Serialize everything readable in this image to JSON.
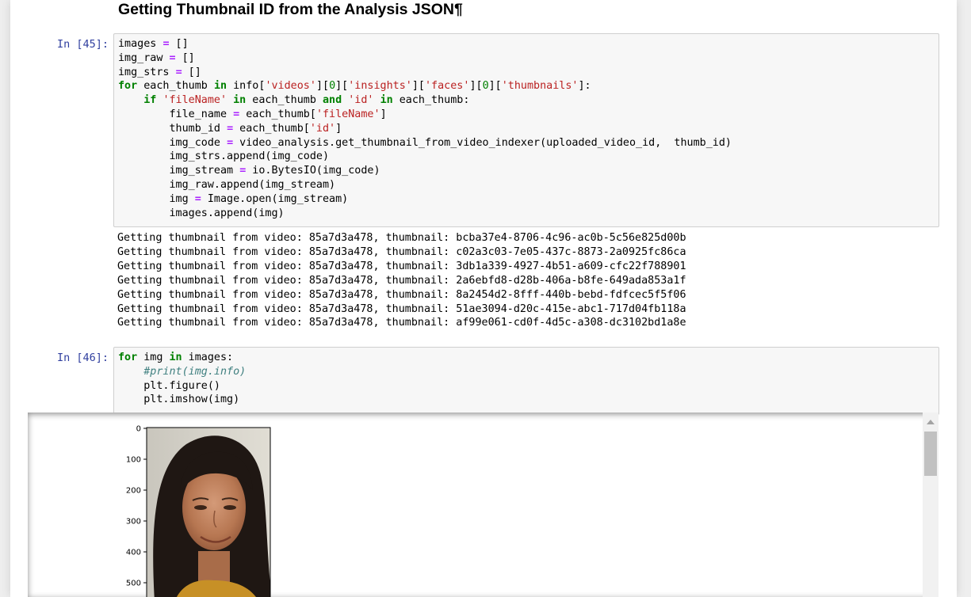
{
  "heading": {
    "text": "Getting Thumbnail ID from the Analysis JSON",
    "anchor": "¶"
  },
  "cell45": {
    "prompt": "In [45]:"
  },
  "cell46": {
    "prompt": "In [46]:"
  },
  "code45": [
    "images = []",
    "img_raw = []",
    "img_strs = []",
    "for each_thumb in info['videos'][0]['insights']['faces'][0]['thumbnails']:",
    "    if 'fileName' in each_thumb and 'id' in each_thumb:",
    "        file_name = each_thumb['fileName']",
    "        thumb_id = each_thumb['id']",
    "        img_code = video_analysis.get_thumbnail_from_video_indexer(uploaded_video_id,  thumb_id)",
    "        img_strs.append(img_code)",
    "        img_stream = io.BytesIO(img_code)",
    "        img_raw.append(img_stream)",
    "        img = Image.open(img_stream)",
    "        images.append(img)"
  ],
  "stdout45": [
    "Getting thumbnail from video: 85a7d3a478, thumbnail: bcba37e4-8706-4c96-ac0b-5c56e825d00b",
    "Getting thumbnail from video: 85a7d3a478, thumbnail: c02a3c03-7e05-437c-8873-2a0925fc86ca",
    "Getting thumbnail from video: 85a7d3a478, thumbnail: 3db1a339-4927-4b51-a609-cfc22f788901",
    "Getting thumbnail from video: 85a7d3a478, thumbnail: 2a6ebfd8-d28b-406a-b8fe-649ada853a1f",
    "Getting thumbnail from video: 85a7d3a478, thumbnail: 8a2454d2-8fff-440b-bebd-fdfcec5f5f06",
    "Getting thumbnail from video: 85a7d3a478, thumbnail: 51ae3094-d20c-415e-abc1-717d04fb118a",
    "Getting thumbnail from video: 85a7d3a478, thumbnail: af99e061-cd0f-4d5c-a308-dc3102bd1a8e"
  ],
  "code46": [
    "for img in images:",
    "    #print(img.info)",
    "    plt.figure()",
    "    plt.imshow(img)"
  ],
  "plot": {
    "yticks": [
      "0",
      "100",
      "200",
      "300",
      "400",
      "500"
    ],
    "image_subject": "thumbnail-face-image"
  },
  "colors": {
    "prompt": "#303f9f",
    "keyword": "#008000",
    "operator": "#aa22ff",
    "string": "#ba2121",
    "comment": "#408080"
  }
}
